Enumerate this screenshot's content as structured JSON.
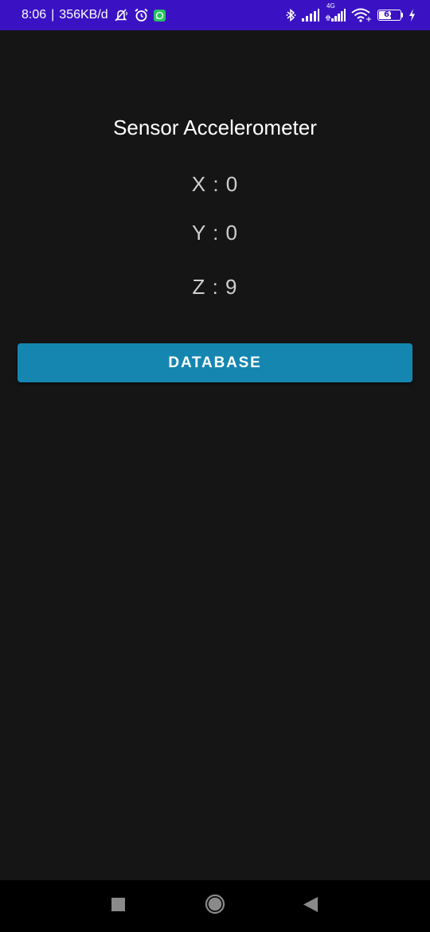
{
  "status_bar": {
    "time": "8:06",
    "separator": "|",
    "network_speed": "356KB/d",
    "network_type": "4G",
    "battery_level": "62",
    "battery_fraction": 0.62,
    "background_color": "#3a12c4",
    "icons": [
      "muted-notifications-icon",
      "alarm-icon",
      "whatsapp-icon",
      "bluetooth-icon",
      "signal-icon",
      "signal-4g-icon",
      "wifi-icon",
      "battery-icon",
      "charging-icon"
    ]
  },
  "main": {
    "title": "Sensor Accelerometer",
    "x_value": "X : 0",
    "y_value": "Y : 0",
    "z_value": "Z : 9",
    "database_button_label": "DATABASE",
    "background_color": "#151515",
    "button_color": "#1586b0"
  },
  "nav_bar": {
    "icons": [
      "recent-apps-icon",
      "home-icon",
      "back-icon"
    ]
  }
}
